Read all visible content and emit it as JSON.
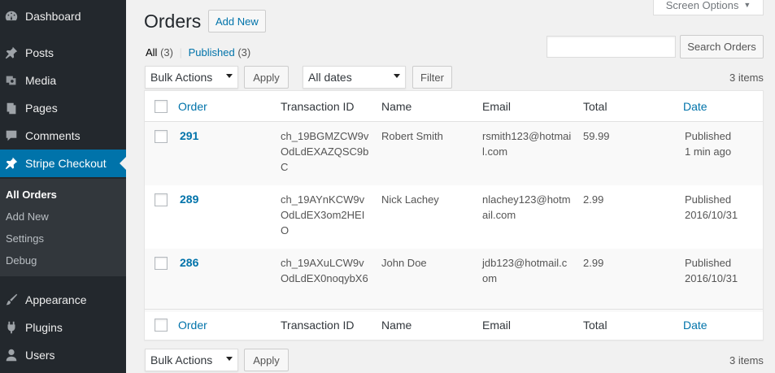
{
  "sidebar": {
    "items": [
      {
        "label": "Dashboard",
        "icon": "dashboard-icon"
      },
      {
        "label": "Posts",
        "icon": "pin-icon"
      },
      {
        "label": "Media",
        "icon": "media-icon"
      },
      {
        "label": "Pages",
        "icon": "pages-icon"
      },
      {
        "label": "Comments",
        "icon": "comment-icon"
      },
      {
        "label": "Stripe Checkout",
        "icon": "pin-icon"
      },
      {
        "label": "Appearance",
        "icon": "brush-icon"
      },
      {
        "label": "Plugins",
        "icon": "plugin-icon"
      },
      {
        "label": "Users",
        "icon": "user-icon"
      }
    ],
    "submenu": [
      "All Orders",
      "Add New",
      "Settings",
      "Debug"
    ]
  },
  "header": {
    "title": "Orders",
    "add_new": "Add New",
    "screen_options": "Screen Options"
  },
  "filters": {
    "all_label": "All",
    "all_count": "(3)",
    "separator": "|",
    "published_label": "Published",
    "published_count": "(3)"
  },
  "search": {
    "button": "Search Orders",
    "value": ""
  },
  "tablenav_top": {
    "bulk_actions": "Bulk Actions",
    "apply": "Apply",
    "dates": "All dates",
    "filter": "Filter",
    "items": "3 items"
  },
  "tablenav_bottom": {
    "bulk_actions": "Bulk Actions",
    "apply": "Apply",
    "items": "3 items"
  },
  "table": {
    "columns": [
      "Order",
      "Transaction ID",
      "Name",
      "Email",
      "Total",
      "Date"
    ],
    "rows": [
      {
        "order": "291",
        "txn": "ch_19BGMZCW9vOdLdEXAZQSC9bC",
        "name": "Robert Smith",
        "email": "rsmith123@hotmail.com",
        "total": "59.99",
        "status": "Published",
        "date": "1 min ago"
      },
      {
        "order": "289",
        "txn": "ch_19AYnKCW9vOdLdEX3om2HEIO",
        "name": "Nick Lachey",
        "email": "nlachey123@hotmail.com",
        "total": "2.99",
        "status": "Published",
        "date": "2016/10/31"
      },
      {
        "order": "286",
        "txn": "ch_19AXuLCW9vOdLdEX0noqybX6",
        "name": "John Doe",
        "email": "jdb123@hotmail.com",
        "total": "2.99",
        "status": "Published",
        "date": "2016/10/31"
      }
    ]
  },
  "colors": {
    "accent": "#0073aa",
    "sidebar_bg": "#23282d",
    "submenu_bg": "#32373c"
  }
}
